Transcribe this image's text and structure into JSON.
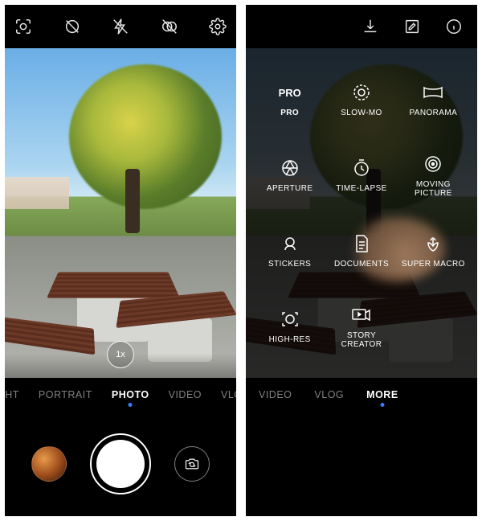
{
  "left": {
    "topbar_icons": [
      "ai-lens-icon",
      "filter-off-icon",
      "flash-off-icon",
      "color-off-icon",
      "settings-icon"
    ],
    "zoom_label": "1x",
    "modes": [
      {
        "label": "GHT",
        "active": false
      },
      {
        "label": "PORTRAIT",
        "active": false
      },
      {
        "label": "PHOTO",
        "active": true
      },
      {
        "label": "VIDEO",
        "active": false
      },
      {
        "label": "VLOG",
        "active": false
      }
    ]
  },
  "right": {
    "topbar_icons": [
      "download-icon",
      "edit-icon",
      "info-icon"
    ],
    "grid": [
      {
        "label": "PRO",
        "icon": "pro-text-icon",
        "bold": true
      },
      {
        "label": "SLOW-MO",
        "icon": "slowmo-icon"
      },
      {
        "label": "PANORAMA",
        "icon": "panorama-icon"
      },
      {
        "label": "APERTURE",
        "icon": "aperture-icon"
      },
      {
        "label": "TIME-LAPSE",
        "icon": "timelapse-icon"
      },
      {
        "label": "MOVING PICTURE",
        "icon": "moving-picture-icon"
      },
      {
        "label": "STICKERS",
        "icon": "stickers-icon"
      },
      {
        "label": "DOCUMENTS",
        "icon": "documents-icon"
      },
      {
        "label": "SUPER MACRO",
        "icon": "macro-icon"
      },
      {
        "label": "HIGH-RES",
        "icon": "highres-icon"
      },
      {
        "label": "STORY CREATOR",
        "icon": "story-icon"
      }
    ],
    "modes": [
      {
        "label": "VIDEO",
        "active": false
      },
      {
        "label": "VLOG",
        "active": false
      },
      {
        "label": "MORE",
        "active": true
      }
    ]
  }
}
